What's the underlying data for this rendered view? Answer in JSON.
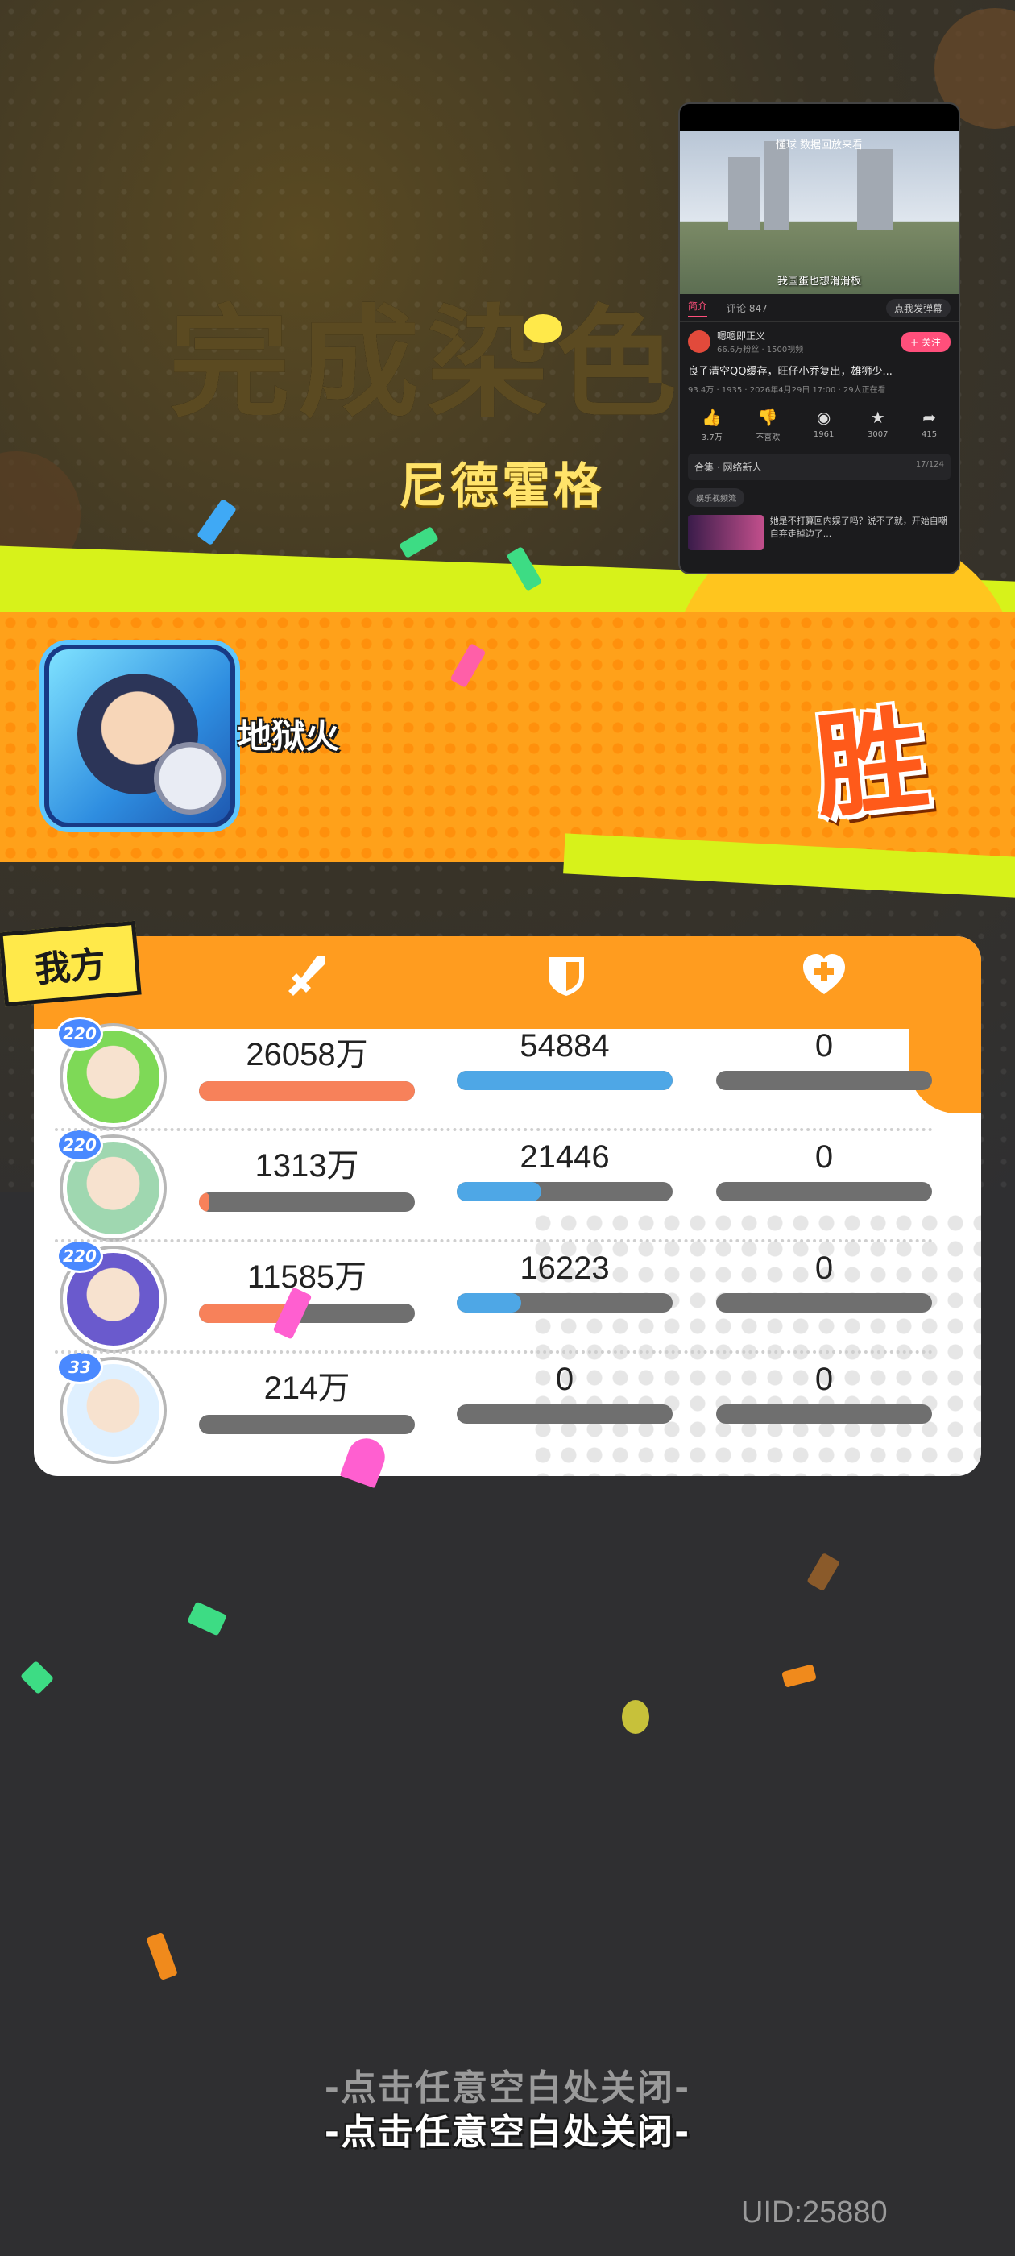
{
  "map_name": "尼德霍格",
  "watermark_title": "完成染色",
  "result": "胜",
  "player": {
    "name": "地狱火"
  },
  "team_label": "我方",
  "columns": [
    {
      "icon": "sword-icon"
    },
    {
      "icon": "shield-icon"
    },
    {
      "icon": "heart-plus-icon"
    }
  ],
  "rows": [
    {
      "level": "220",
      "damage": "26058万",
      "damage_fill": 1.0,
      "tank": "54884",
      "tank_fill": 1.0,
      "heal": "0",
      "heal_fill": 0,
      "avatar_color": "#7ed957"
    },
    {
      "level": "220",
      "damage": "1313万",
      "damage_fill": 0.05,
      "tank": "21446",
      "tank_fill": 0.39,
      "heal": "0",
      "heal_fill": 0,
      "avatar_color": "#9fd7b0"
    },
    {
      "level": "220",
      "damage": "11585万",
      "damage_fill": 0.44,
      "tank": "16223",
      "tank_fill": 0.3,
      "heal": "0",
      "heal_fill": 0,
      "avatar_color": "#6a5acd"
    },
    {
      "level": "33",
      "damage": "214万",
      "damage_fill": 0.0,
      "tank": "0",
      "tank_fill": 0,
      "heal": "0",
      "heal_fill": 0,
      "avatar_color": "#dff0ff"
    }
  ],
  "colors": {
    "damage": "#f7815a",
    "tank": "#4ea7e6",
    "heal": "#ff7aa0",
    "track": "#6f6f6f"
  },
  "close_hint": "-点击任意空白处关闭-",
  "uid": "UID:25880",
  "video": {
    "top_caption": "懂球 数据回放来看",
    "bottom_caption": "我国蛋也想滑滑板",
    "tab_intro": "简介",
    "tab_comments": "评论 847",
    "danmaku": "点我发弹幕",
    "uploader_name": "嗯嗯即正义",
    "uploader_sub": "66.6万粉丝 · 1500视频",
    "follow": "+ 关注",
    "title": "良子清空QQ缓存，旺仔小乔复出，雄狮少...",
    "meta": "93.4万 · 1935 · 2026年4月29日 17:00 · 29人正在看",
    "actions": [
      {
        "icon": "thumb-up-icon",
        "label": "3.7万"
      },
      {
        "icon": "thumb-down-icon",
        "label": "不喜欢"
      },
      {
        "icon": "coin-icon",
        "label": "1961"
      },
      {
        "icon": "star-icon",
        "label": "3007"
      },
      {
        "icon": "share-icon",
        "label": "415"
      }
    ],
    "collection": "合集 · 网络新人",
    "collection_progress": "17/124",
    "tag": "娱乐视频流",
    "rec_text": "她是不打算回内娱了吗？说不了就，开始自嘲自弃走掉边了..."
  }
}
